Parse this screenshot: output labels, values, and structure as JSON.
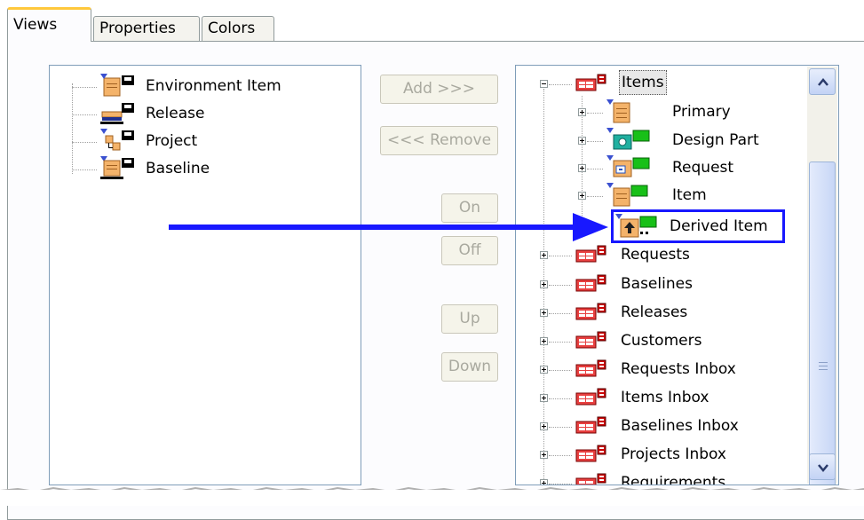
{
  "tabs": [
    {
      "label": "Views"
    },
    {
      "label": "Properties"
    },
    {
      "label": "Colors"
    }
  ],
  "left_tree": [
    {
      "label": "Environment Item",
      "icon": "environment-item-icon"
    },
    {
      "label": "Release",
      "icon": "release-icon"
    },
    {
      "label": "Project",
      "icon": "project-icon"
    },
    {
      "label": "Baseline",
      "icon": "baseline-icon"
    }
  ],
  "buttons": {
    "add": "Add >>>",
    "remove": "<<< Remove",
    "on": "On",
    "off": "Off",
    "up": "Up",
    "down": "Down"
  },
  "right_tree": {
    "root": "Items",
    "children": [
      {
        "label": "Primary",
        "icon": "primary-item-icon"
      },
      {
        "label": "Design Part",
        "icon": "design-part-icon"
      },
      {
        "label": "Request",
        "icon": "request-icon"
      },
      {
        "label": "Item",
        "icon": "item-icon"
      },
      {
        "label": "Derived Item",
        "icon": "derived-item-icon"
      }
    ],
    "folders": [
      {
        "label": "Requests"
      },
      {
        "label": "Baselines"
      },
      {
        "label": "Releases"
      },
      {
        "label": "Customers"
      },
      {
        "label": "Requests Inbox"
      },
      {
        "label": "Items Inbox"
      },
      {
        "label": "Baselines Inbox"
      },
      {
        "label": "Projects Inbox"
      },
      {
        "label": "Requirements"
      }
    ]
  },
  "colors": {
    "highlight": "#1818ff",
    "active_tab_accent": "#ffc83c"
  }
}
